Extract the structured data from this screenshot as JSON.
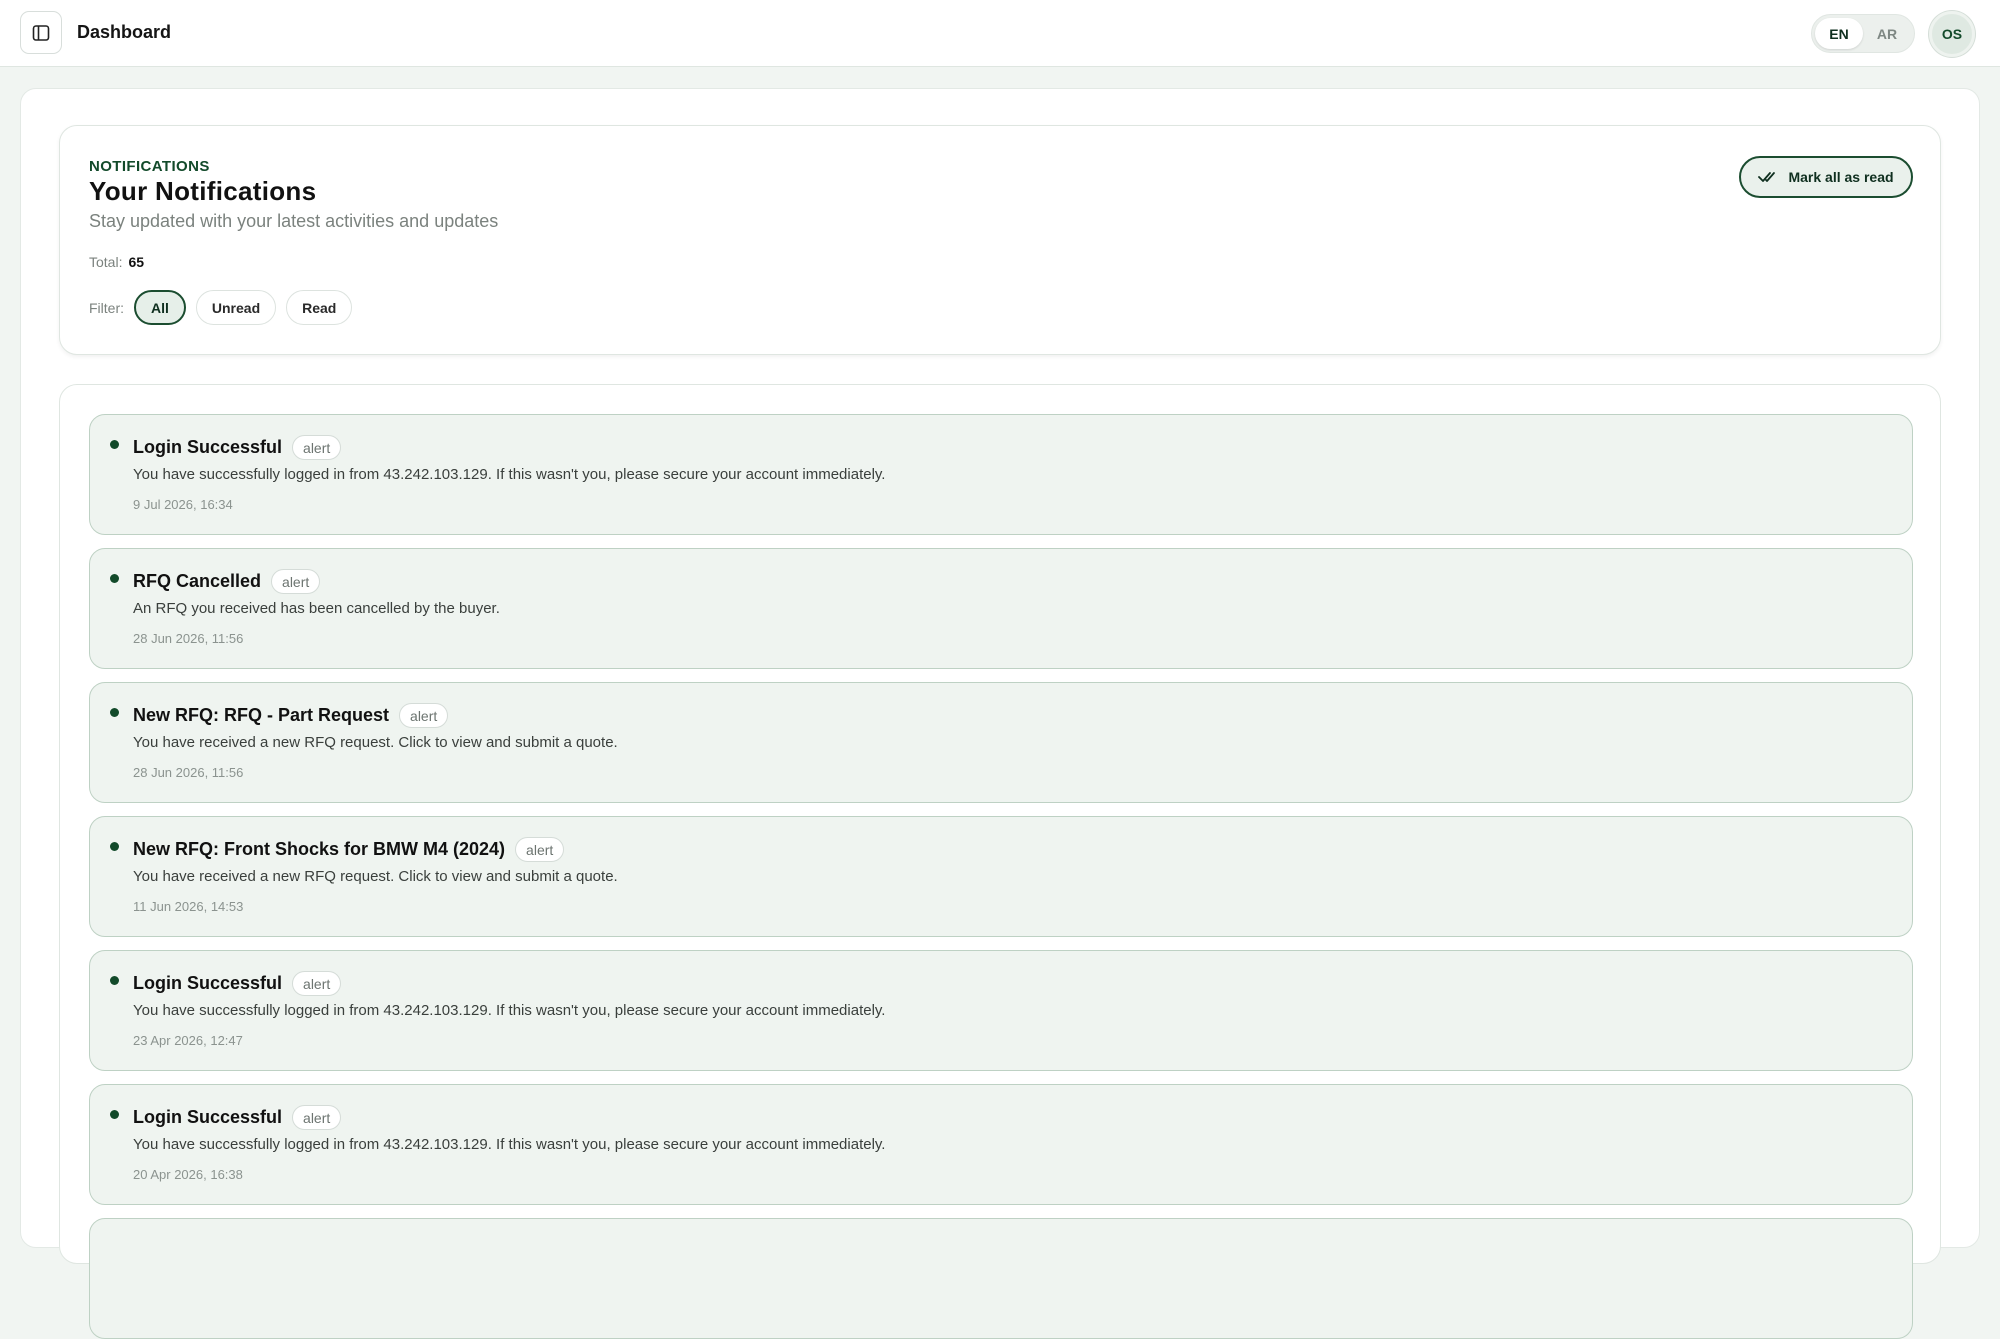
{
  "topbar": {
    "title": "Dashboard",
    "lang": {
      "en": "EN",
      "ar": "AR",
      "active": "EN"
    },
    "avatar_initials": "OS"
  },
  "header": {
    "eyebrow": "NOTIFICATIONS",
    "title": "Your Notifications",
    "subtitle": "Stay updated with your latest activities and updates",
    "total_label": "Total:",
    "total_value": "65",
    "filter_label": "Filter:",
    "filters": [
      "All",
      "Unread",
      "Read"
    ],
    "active_filter": "All",
    "mark_all_label": "Mark all as read"
  },
  "notifications": [
    {
      "title": "Login Successful",
      "badge": "alert",
      "message": "You have successfully logged in from 43.242.103.129. If this wasn't you, please secure your account immediately.",
      "time": "9 Jul 2026, 16:34"
    },
    {
      "title": "RFQ Cancelled",
      "badge": "alert",
      "message": "An RFQ you received has been cancelled by the buyer.",
      "time": "28 Jun 2026, 11:56"
    },
    {
      "title": "New RFQ: RFQ - Part Request",
      "badge": "alert",
      "message": "You have received a new RFQ request. Click to view and submit a quote.",
      "time": "28 Jun 2026, 11:56"
    },
    {
      "title": "New RFQ: Front Shocks for BMW M4 (2024)",
      "badge": "alert",
      "message": "You have received a new RFQ request. Click to view and submit a quote.",
      "time": "11 Jun 2026, 14:53"
    },
    {
      "title": "Login Successful",
      "badge": "alert",
      "message": "You have successfully logged in from 43.242.103.129. If this wasn't you, please secure your account immediately.",
      "time": "23 Apr 2026, 12:47"
    },
    {
      "title": "Login Successful",
      "badge": "alert",
      "message": "You have successfully logged in from 43.242.103.129. If this wasn't you, please secure your account immediately.",
      "time": "20 Apr 2026, 16:38"
    }
  ],
  "colors": {
    "accent": "#1b4d30",
    "unread_dot": "#124a2a",
    "item_bg": "#eff4f0",
    "page_bg": "#f1f5f2"
  }
}
